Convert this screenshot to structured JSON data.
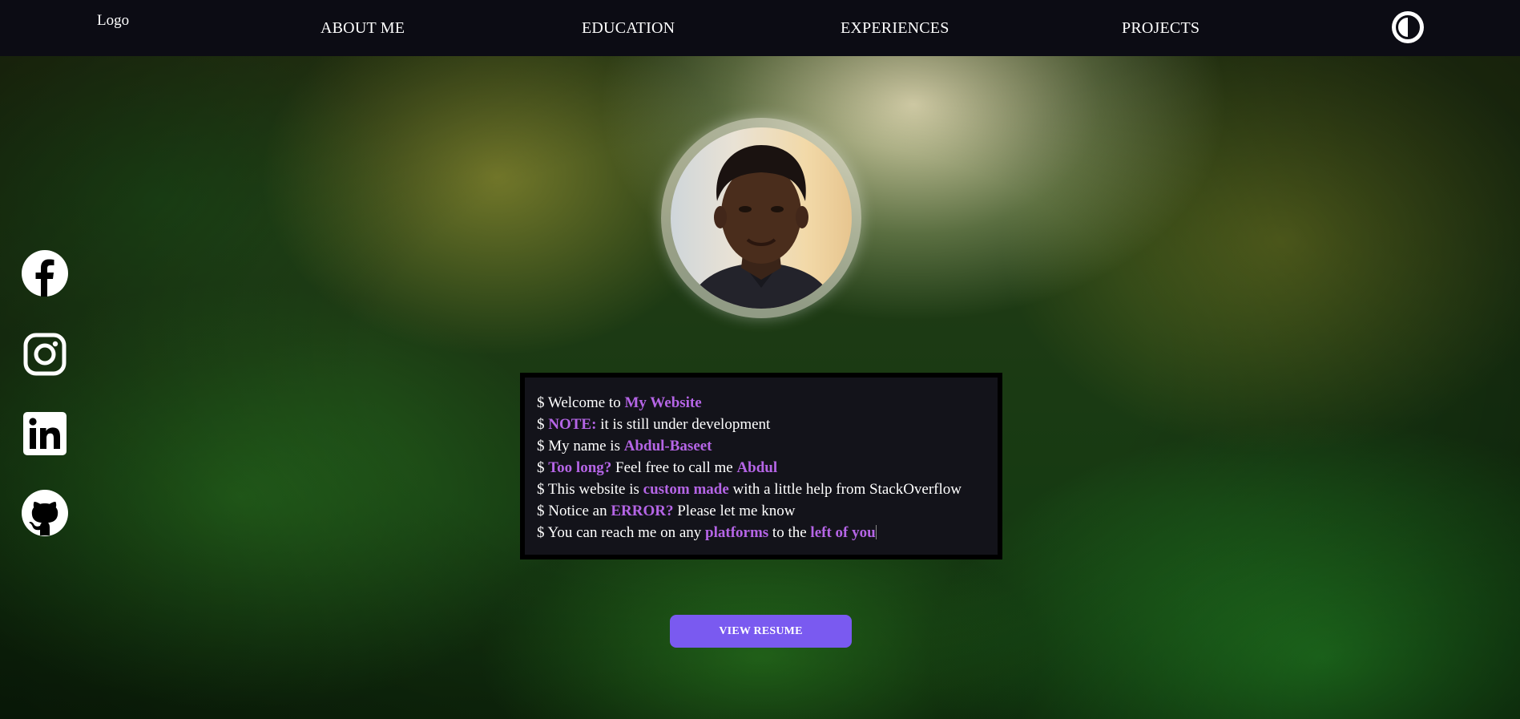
{
  "nav": {
    "logo": "Logo",
    "links": [
      "ABOUT ME",
      "EDUCATION",
      "EXPERIENCES",
      "PROJECTS"
    ]
  },
  "social": [
    "facebook-icon",
    "instagram-icon",
    "linkedin-icon",
    "github-icon"
  ],
  "terminal": {
    "lines": [
      [
        {
          "t": "$ Welcome to "
        },
        {
          "t": "My Website",
          "hl": true
        }
      ],
      [
        {
          "t": "$ "
        },
        {
          "t": "NOTE:",
          "hl": true
        },
        {
          "t": " it is still under development"
        }
      ],
      [
        {
          "t": "$ My name is "
        },
        {
          "t": "Abdul-Baseet",
          "hl": true
        }
      ],
      [
        {
          "t": "$ "
        },
        {
          "t": "Too long?",
          "hl": true
        },
        {
          "t": " Feel free to call me "
        },
        {
          "t": "Abdul",
          "hl": true
        }
      ],
      [
        {
          "t": "$ This website is "
        },
        {
          "t": "custom made",
          "hl": true
        },
        {
          "t": " with a little help from StackOverflow"
        }
      ],
      [
        {
          "t": "$ Notice an "
        },
        {
          "t": "ERROR?",
          "hl": true
        },
        {
          "t": " Please let me know"
        }
      ],
      [
        {
          "t": "$ You can reach me on any "
        },
        {
          "t": "platforms",
          "hl": true
        },
        {
          "t": " to the "
        },
        {
          "t": "left of you",
          "hl": true
        }
      ]
    ]
  },
  "resume_button": "VIEW RESUME",
  "colors": {
    "nav_bg": "#0c0c14",
    "accent": "#b565e6",
    "button": "#7a5af0",
    "terminal_bg": "#13131a"
  }
}
